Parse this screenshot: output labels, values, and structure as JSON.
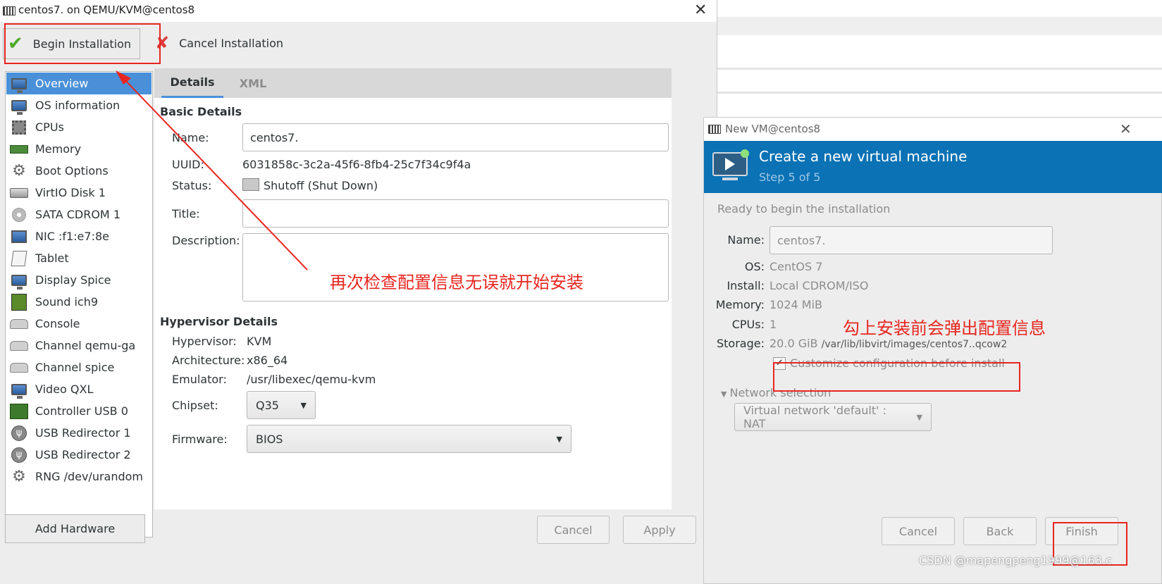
{
  "main_window": {
    "title": "centos7. on QEMU/KVM@centos8",
    "toolbar": {
      "begin_label": "Begin Installation",
      "cancel_label": "Cancel Installation"
    },
    "sidebar": {
      "items": [
        {
          "label": "Overview",
          "icon": "monitor-icon",
          "selected": true
        },
        {
          "label": "OS information",
          "icon": "monitor-icon"
        },
        {
          "label": "CPUs",
          "icon": "chip-icon"
        },
        {
          "label": "Memory",
          "icon": "ram-icon"
        },
        {
          "label": "Boot Options",
          "icon": "gear-icon"
        },
        {
          "label": "VirtIO Disk 1",
          "icon": "disk-icon"
        },
        {
          "label": "SATA CDROM 1",
          "icon": "cdrom-icon"
        },
        {
          "label": "NIC :f1:e7:8e",
          "icon": "nic-icon"
        },
        {
          "label": "Tablet",
          "icon": "tablet-icon"
        },
        {
          "label": "Display Spice",
          "icon": "monitor-icon"
        },
        {
          "label": "Sound ich9",
          "icon": "sound-icon"
        },
        {
          "label": "Console",
          "icon": "console-icon"
        },
        {
          "label": "Channel qemu-ga",
          "icon": "console-icon"
        },
        {
          "label": "Channel spice",
          "icon": "console-icon"
        },
        {
          "label": "Video QXL",
          "icon": "monitor-icon"
        },
        {
          "label": "Controller USB 0",
          "icon": "usb-controller-icon"
        },
        {
          "label": "USB Redirector 1",
          "icon": "usb-icon"
        },
        {
          "label": "USB Redirector 2",
          "icon": "usb-icon"
        },
        {
          "label": "RNG /dev/urandom",
          "icon": "gear-icon"
        }
      ],
      "add_hardware_label": "Add Hardware"
    },
    "tabs": {
      "details": "Details",
      "xml": "XML"
    },
    "basic": {
      "heading": "Basic Details",
      "name_label": "Name:",
      "name_value": "centos7.",
      "uuid_label": "UUID:",
      "uuid_value": "6031858c-3c2a-45f6-8fb4-25c7f34c9f4a",
      "status_label": "Status:",
      "status_value": "Shutoff (Shut Down)",
      "title_label": "Title:",
      "title_value": "",
      "description_label": "Description:",
      "description_value": ""
    },
    "hypervisor": {
      "heading": "Hypervisor Details",
      "hypervisor_label": "Hypervisor:",
      "hypervisor_value": "KVM",
      "arch_label": "Architecture:",
      "arch_value": "x86_64",
      "emulator_label": "Emulator:",
      "emulator_value": "/usr/libexec/qemu-kvm",
      "chipset_label": "Chipset:",
      "chipset_value": "Q35",
      "firmware_label": "Firmware:",
      "firmware_value": "BIOS"
    },
    "footer": {
      "cancel_label": "Cancel",
      "apply_label": "Apply"
    }
  },
  "annotation_left": "再次检查配置信息无误就开始安装",
  "annotation_right": "勾上安装前会弹出配置信息",
  "dialog": {
    "title": "New VM@centos8",
    "banner_title": "Create a new virtual machine",
    "banner_step": "Step 5 of 5",
    "ready_text": "Ready to begin the installation",
    "name_label": "Name:",
    "name_value": "centos7.",
    "os_label": "OS:",
    "os_value": "CentOS 7",
    "install_label": "Install:",
    "install_value": "Local CDROM/ISO",
    "memory_label": "Memory:",
    "memory_value": "1024 MiB",
    "cpus_label": "CPUs:",
    "cpus_value": "1",
    "storage_label": "Storage:",
    "storage_size": "20.0 GiB",
    "storage_path": "/var/lib/libvirt/images/centos7..qcow2",
    "customize_label": "Customize configuration before install",
    "customize_checked": true,
    "network_label": "Network selection",
    "network_value": "Virtual network 'default' : NAT",
    "cancel_label": "Cancel",
    "back_label": "Back",
    "finish_label": "Finish"
  },
  "watermark": "CSDN @mapengpeng1999@163.c",
  "colors": {
    "accent": "#4a90d9",
    "banner": "#0a72b5",
    "annotation": "#e8251f"
  }
}
